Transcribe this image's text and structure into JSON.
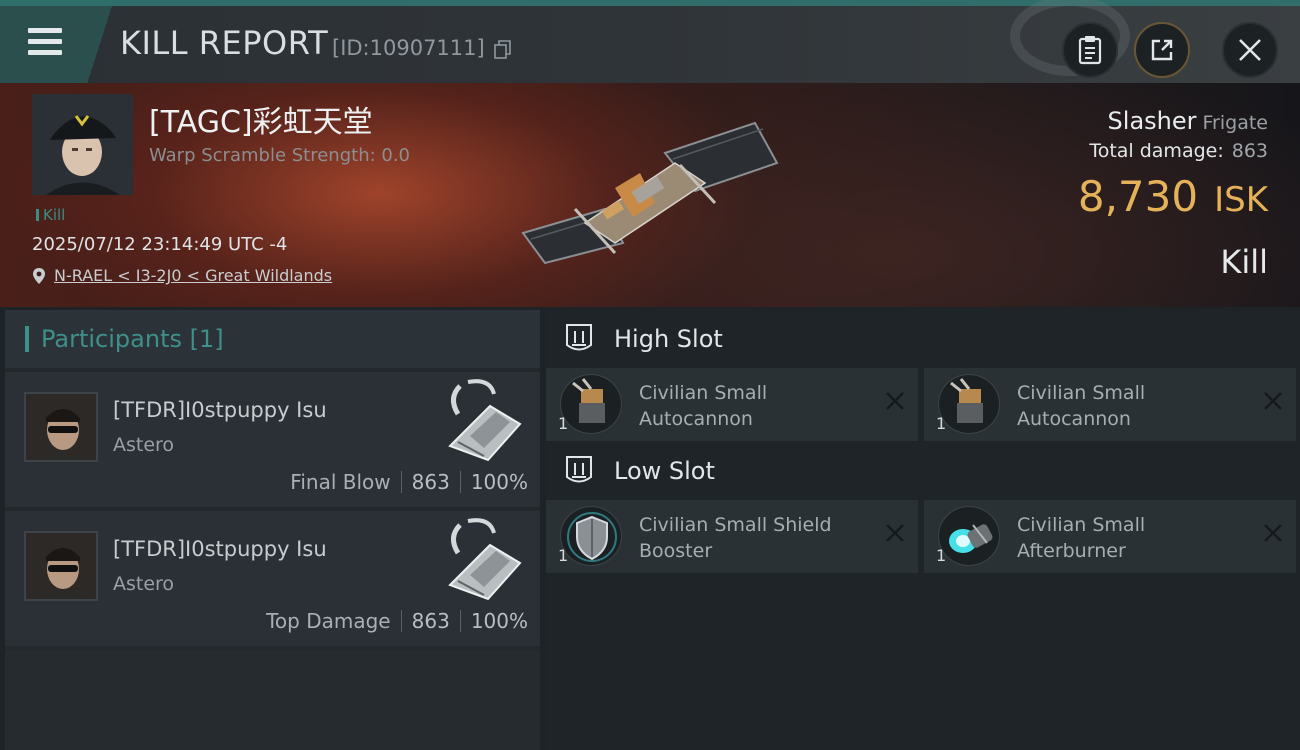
{
  "header": {
    "title": "KILL REPORT",
    "report_id": "[ID:10907111]"
  },
  "victim": {
    "name": "[TAGC]彩虹天堂",
    "scramble": "Warp Scramble Strength: 0.0",
    "tag": "Kill",
    "timestamp": "2025/07/12 23:14:49 UTC -4",
    "location": "N-RAEL < I3-2J0 < Great Wildlands",
    "ship": "Slasher",
    "ship_class": "Frigate",
    "total_damage_label": "Total damage:",
    "total_damage": "863",
    "isk_value": "8,730",
    "isk_unit": "ISK",
    "outcome": "Kill"
  },
  "participants": {
    "label": "Participants",
    "count": "[1]",
    "rows": [
      {
        "name": "[TFDR]I0stpuppy Isu",
        "ship": "Astero",
        "role": "Final Blow",
        "damage": "863",
        "percent": "100%"
      },
      {
        "name": "[TFDR]I0stpuppy Isu",
        "ship": "Astero",
        "role": "Top Damage",
        "damage": "863",
        "percent": "100%"
      }
    ]
  },
  "fittings": {
    "high_slot": {
      "label": "High Slot",
      "modules": [
        {
          "name": "Civilian Small Autocannon",
          "qty": "1"
        },
        {
          "name": "Civilian Small Autocannon",
          "qty": "1"
        }
      ]
    },
    "low_slot": {
      "label": "Low Slot",
      "modules": [
        {
          "name": "Civilian Small Shield Booster",
          "qty": "1"
        },
        {
          "name": "Civilian Small Afterburner",
          "qty": "1"
        }
      ]
    }
  },
  "colors": {
    "accent_teal": "#3f8f8a",
    "isk_gold": "#e5b259"
  }
}
